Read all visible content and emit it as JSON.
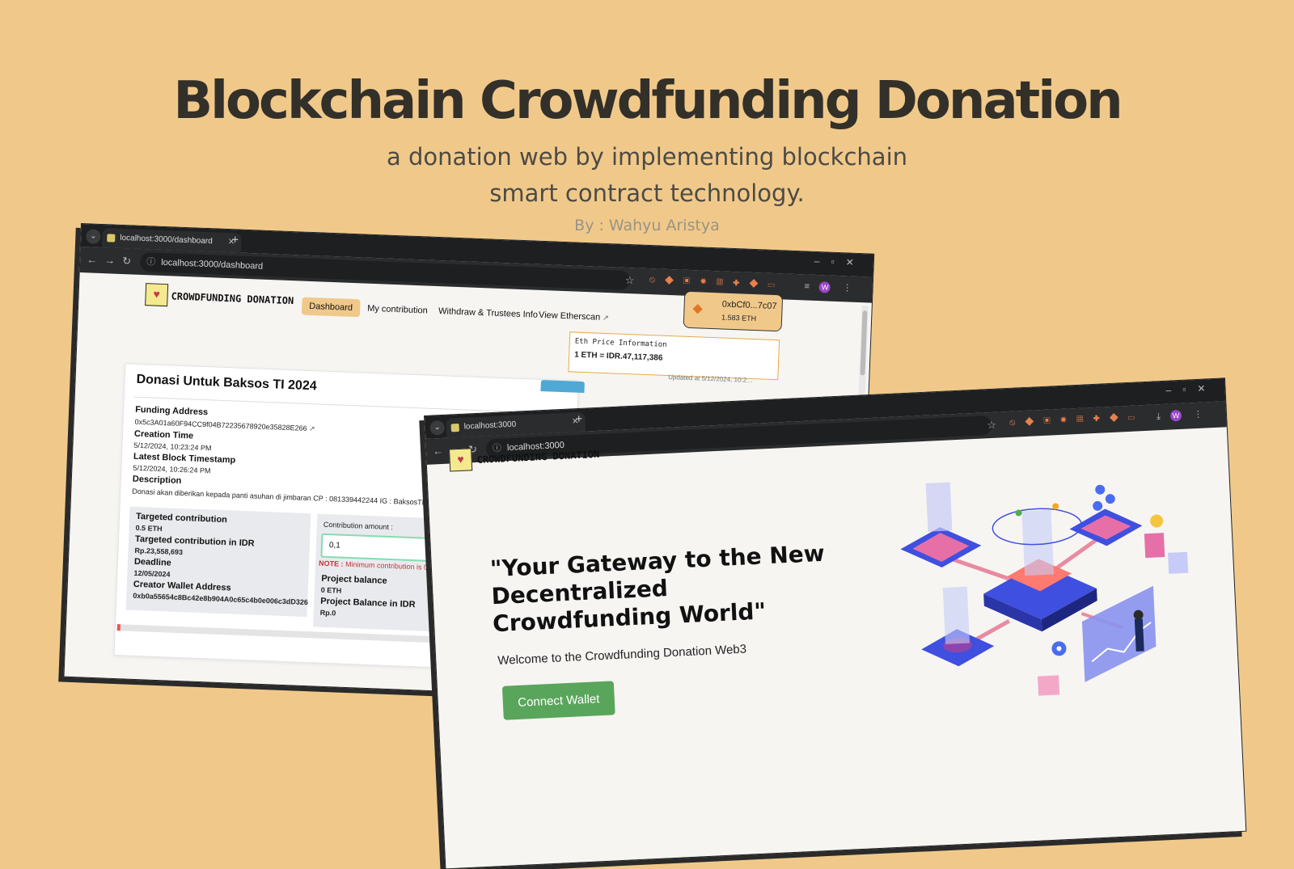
{
  "hero": {
    "title": "Blockchain Crowdfunding Donation",
    "subtitle": "a donation web by implementing blockchain smart contract technology.",
    "byline": "By : Wahyu Aristya"
  },
  "back_window": {
    "tab_title": "localhost:3000/dashboard",
    "url": "localhost:3000/dashboard",
    "brand": "CROWDFUNDING DONATION",
    "nav": [
      "Dashboard",
      "My contribution",
      "Withdraw & Trustees Info",
      "View Etherscan"
    ],
    "wallet": {
      "address": "0xbCf0...7c07",
      "balance": "1.583 ETH"
    },
    "eth_price": {
      "title": "Eth Price Information",
      "value": "1 ETH = IDR.47,117,386",
      "updated": "Updated at 5/12/2024, 10:2…"
    },
    "campaign": {
      "title": "Donasi Untuk Baksos TI 2024",
      "funding_address_label": "Funding Address",
      "funding_address": "0x5c3A01a60F94CC9f04B72235678920e35828E266",
      "creation_time_label": "Creation Time",
      "creation_time": "5/12/2024, 10:23:24 PM",
      "latest_block_label": "Latest Block Timestamp",
      "latest_block": "5/12/2024, 10:26:24 PM",
      "description_label": "Description",
      "description": "Donasi akan diberikan kepada panti asuhan di jimbaran CP : 081339442244 IG : BaksosTI2024",
      "targeted_label": "Targeted contribution",
      "targeted": "0.5 ETH",
      "targeted_idr_label": "Targeted contribution in IDR",
      "targeted_idr": "Rp.23,558,693",
      "deadline_label": "Deadline",
      "deadline": "12/05/2024",
      "creator_label": "Creator Wallet Address",
      "creator": "0xb0a55654c8Bc42e8b904A0c65c4b0e006c3dD326",
      "contribution_label": "Contribution amount :",
      "contribution_value": "0,1",
      "note_prefix": "NOTE :",
      "note_text": "Minimum contribution is 0.0001 ETH",
      "balance_label": "Project balance",
      "balance": "0 ETH",
      "balance_idr_label": "Project Balance in IDR",
      "balance_idr": "Rp.0",
      "progress": 0.01
    }
  },
  "front_window": {
    "tab_title": "localhost:3000",
    "url": "localhost:3000",
    "brand": "CROWDFUNDING DONATION",
    "headline": "\"Your Gateway to the New Decentralized Crowdfunding World\"",
    "welcome": "Welcome to the Crowdfunding Donation Web3",
    "cta": "Connect Wallet"
  },
  "colors": {
    "background": "#F0C98A",
    "cta": "#5aa55c",
    "accent": "#F0C98A"
  },
  "icons": [
    "back-arrow-icon",
    "forward-arrow-icon",
    "reload-icon",
    "star-icon",
    "metamask-fox-icon",
    "external-link-icon"
  ]
}
